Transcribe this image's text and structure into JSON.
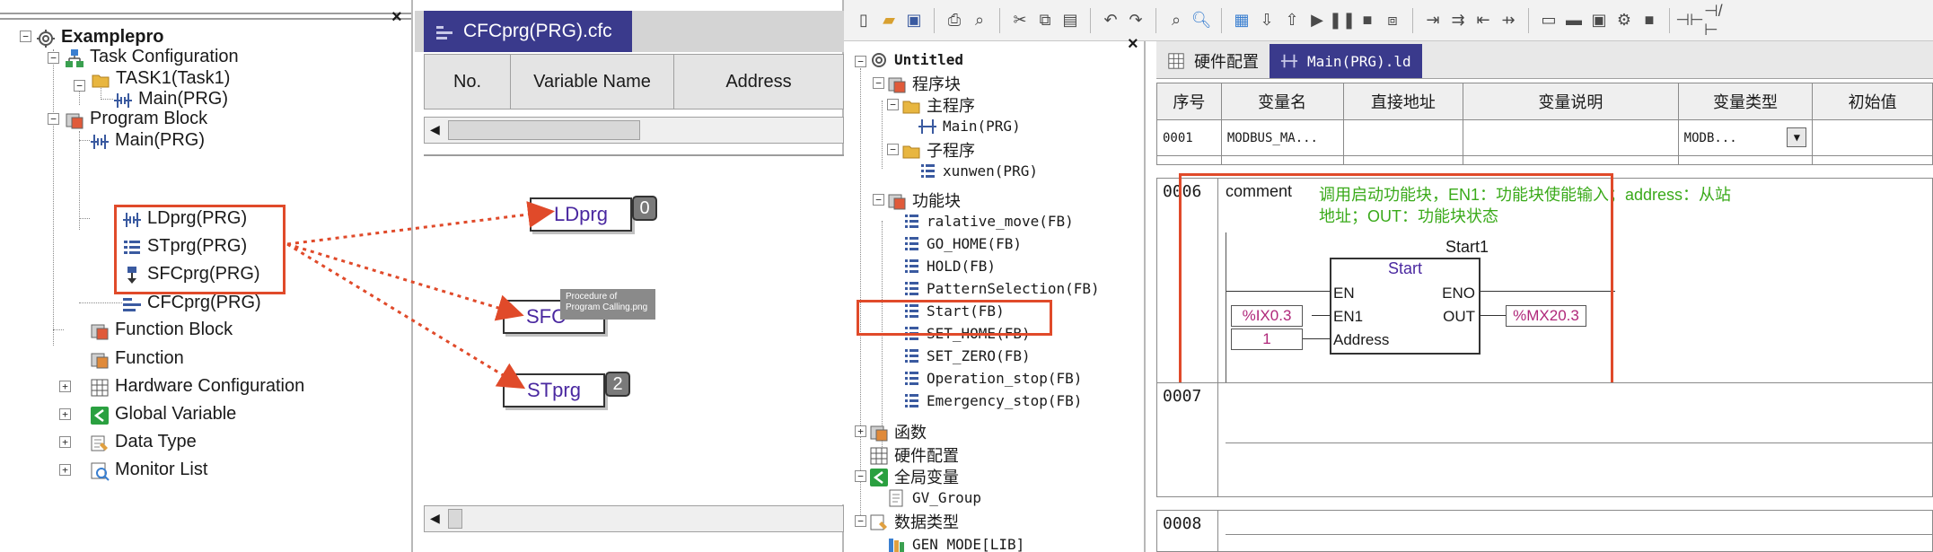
{
  "left_tree": {
    "root": "Examplepro",
    "task_configuration": "Task Configuration",
    "task1": "TASK1(Task1)",
    "task_main": "Main(PRG)",
    "program_block": "Program Block",
    "pb_main": "Main(PRG)",
    "pb_ld": "LDprg(PRG)",
    "pb_st": "STprg(PRG)",
    "pb_sfc": "SFCprg(PRG)",
    "pb_cfc": "CFCprg(PRG)",
    "function_block": "Function Block",
    "function": "Function",
    "hardware_configuration": "Hardware Configuration",
    "global_variable": "Global Variable",
    "data_type": "Data Type",
    "monitor_list": "Monitor List",
    "close_glyph": "×"
  },
  "cfc_editor": {
    "tab": "CFCprg(PRG).cfc",
    "columns": [
      "No.",
      "Variable Name",
      "Address"
    ],
    "blocks": {
      "ld": "LDprg",
      "ld_badge": "0",
      "sfc": "SFC",
      "st": "STprg",
      "st_badge": "2"
    },
    "tooltip": "Procedure of Program Calling.png"
  },
  "cn_tree": {
    "root": "Untitled",
    "program_blocks": "程序块",
    "main_programs": "主程序",
    "main": "Main(PRG)",
    "sub_programs": "子程序",
    "xunwen": "xunwen(PRG)",
    "function_blocks": "功能块",
    "fb_items": [
      "ralative_move(FB)",
      "GO_HOME(FB)",
      "HOLD(FB)",
      "PatternSelection(FB)",
      "Start(FB)",
      "SET_HOME(FB)",
      "SET_ZERO(FB)",
      "Operation_stop(FB)",
      "Emergency_stop(FB)"
    ],
    "functions": "函数",
    "hardware_config": "硬件配置",
    "global_variables": "全局变量",
    "gv_group": "GV_Group",
    "data_types": "数据类型",
    "gen_mode": "GEN_MODE[LIB]",
    "close_glyph": "×"
  },
  "ld_editor": {
    "tabs": [
      "硬件配置",
      "Main(PRG).ld"
    ],
    "columns": [
      "序号",
      "变量名",
      "直接地址",
      "变量说明",
      "变量类型",
      "初始值"
    ],
    "row": {
      "no": "0001",
      "name": "MODBUS_MA...",
      "address": "",
      "comment": "",
      "type": "MODB...",
      "init": ""
    },
    "rung_0006": {
      "number": "0006",
      "comment_label": "comment",
      "comment_text_1": "调用启动功能块，EN1：功能块使能输入；address：从站",
      "comment_text_2": "地址；OUT：功能块状态",
      "instance": "Start1",
      "fb_type": "Start",
      "pin_en": "EN",
      "pin_eno": "ENO",
      "pin_en1": "EN1",
      "pin_out": "OUT",
      "pin_address": "Address",
      "in_en1": "%IX0.3",
      "in_address": "1",
      "out_var": "%MX20.3"
    },
    "rung_0007": "0007",
    "rung_0008": "0008"
  },
  "colors": {
    "highlight_red": "#e04a2a",
    "comment_green": "#3aaa1a",
    "block_purple": "#4a28a0",
    "tab_blue": "#3a3a8c",
    "var_magenta": "#b0287a"
  }
}
